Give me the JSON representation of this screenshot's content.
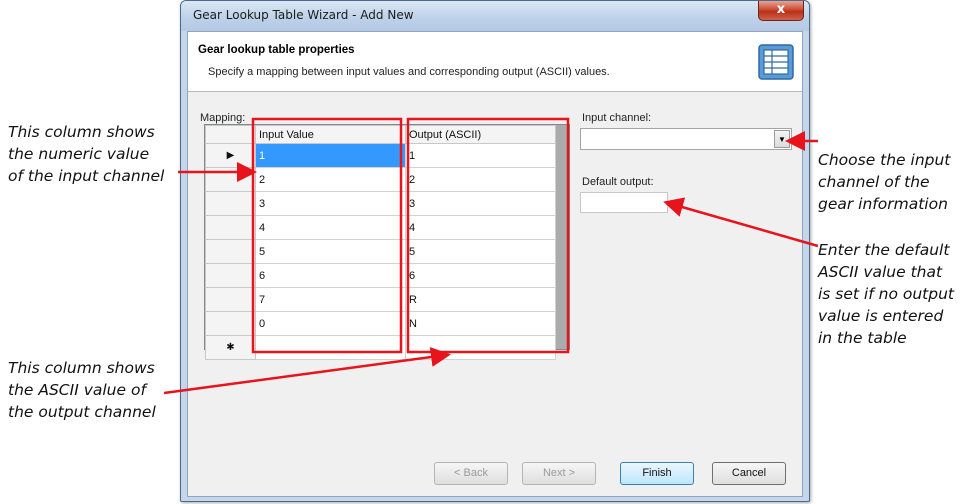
{
  "annotations": {
    "input_column": [
      "This column shows",
      "the numeric value",
      "of the input channel"
    ],
    "output_column": [
      "This column shows",
      "the ASCII value of",
      "the output channel"
    ],
    "input_channel": [
      "Choose the input",
      "channel of the",
      "gear information"
    ],
    "default_output": [
      "Enter the default",
      "ASCII value that",
      "is set if no output",
      "value is entered",
      "in the table"
    ]
  },
  "window": {
    "title": "Gear Lookup Table Wizard - Add New",
    "close_label": "x"
  },
  "header": {
    "title": "Gear lookup table properties",
    "subtitle": "Specify a mapping between input values and corresponding output (ASCII) values.",
    "icon": "table-icon"
  },
  "mapping": {
    "label": "Mapping:",
    "columns": [
      "Input Value",
      "Output (ASCII)"
    ],
    "current_row_marker": "▶",
    "new_row_marker": "✱",
    "rows": [
      {
        "input": "1",
        "output": "1"
      },
      {
        "input": "2",
        "output": "2"
      },
      {
        "input": "3",
        "output": "3"
      },
      {
        "input": "4",
        "output": "4"
      },
      {
        "input": "5",
        "output": "5"
      },
      {
        "input": "6",
        "output": "6"
      },
      {
        "input": "7",
        "output": "R"
      },
      {
        "input": "0",
        "output": "N"
      }
    ]
  },
  "input_channel": {
    "label": "Input channel:",
    "value": "",
    "dropdown_glyph": "▼"
  },
  "default_output": {
    "label": "Default output:",
    "value": ""
  },
  "buttons": {
    "back": "< Back",
    "next": "Next >",
    "finish": "Finish",
    "cancel": "Cancel"
  },
  "colors": {
    "highlight": "#e8141c",
    "selection": "#3399ff"
  }
}
